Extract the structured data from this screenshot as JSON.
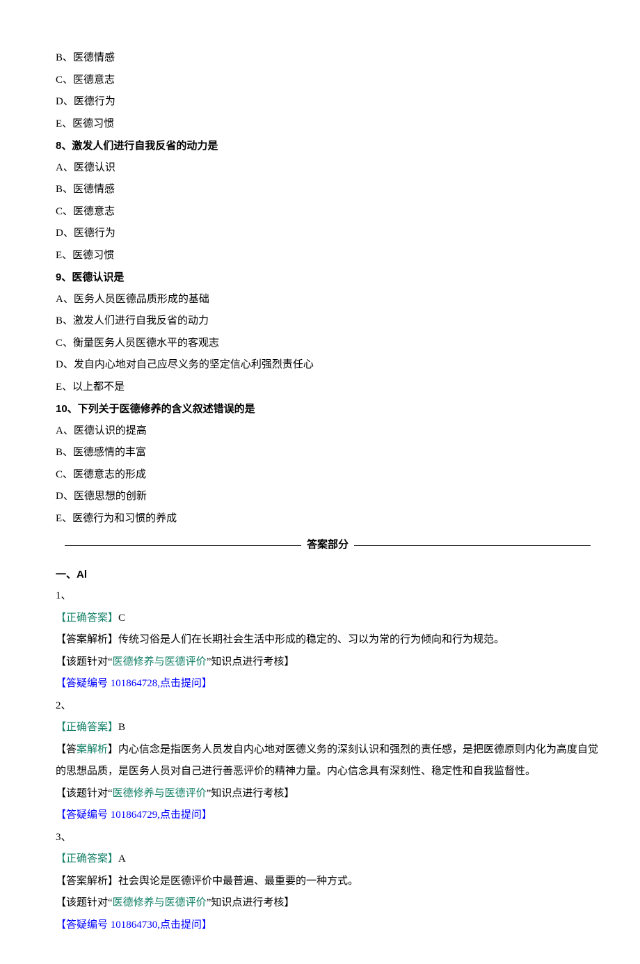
{
  "q7": {
    "options": {
      "B": "B、医德情感",
      "C": "C、医德意志",
      "D": "D、医德行为",
      "E": "E、医德习惯"
    }
  },
  "q8": {
    "prompt": "8、激发人们进行自我反省的动力是",
    "options": {
      "A": "A、医德认识",
      "B": "B、医德情感",
      "C": "C、医德意志",
      "D": "D、医德行为",
      "E": "E、医德习惯"
    }
  },
  "q9": {
    "prompt": "9、医德认识是",
    "options": {
      "A": "A、医务人员医德品质形成的基础",
      "B": "B、激发人们进行自我反省的动力",
      "C": "C、衡量医务人员医德水平的客观志",
      "D": "D、发自内心地对自己应尽义务的坚定信心利强烈责任心",
      "E": "E、以上都不是"
    }
  },
  "q10": {
    "prompt": "10、下列关于医德修养的含义叙述错误的是",
    "options": {
      "A": "A、医德认识的提高",
      "B": "B、医德感情的丰富",
      "C": "C、医德意志的形成",
      "D": "D、医德思想的创新",
      "E": "E、医德行为和习惯的养成"
    }
  },
  "answer_header": "答案部分",
  "section": "一、Al",
  "labels": {
    "correct_open": "【正确",
    "answer_mid": "答案",
    "close_bracket": "】",
    "correct_full": "【正确答案】",
    "analysis_open": "【答",
    "analysis_mid": "案解析",
    "analysis_close": "】",
    "analysis_full": "【答案解析】",
    "topic_open": "【该题针对“",
    "topic_mid": "医德修养与医德评价",
    "topic_close": "”知识点进行考核】",
    "qa_open": "【",
    "qa_body": "答疑编号 ",
    "qa_close": ",点击提问",
    "qa_bracket_close": "】"
  },
  "a1": {
    "num": "1、",
    "ans": "C",
    "analysis": "传统习俗是人们在长期社会生活中形成的稳定的、习以为常的行为倾向和行为规范。",
    "qa_id": "101864728"
  },
  "a2": {
    "num": "2、",
    "ans": "B",
    "analysis": "内心信念是指医务人员发自内心地对医德义务的深刻认识和强烈的责任感，是把医德原则内化为高度自觉的思想品质，是医务人员对自己进行善恶评价的精神力量。内心信念具有深刻性、稳定性和自我监督性。",
    "qa_id": "101864729"
  },
  "a3": {
    "num": "3、",
    "ans": "A",
    "analysis": "社会舆论是医德评价中最普遍、最重要的一种方式。",
    "qa_id": "101864730"
  }
}
